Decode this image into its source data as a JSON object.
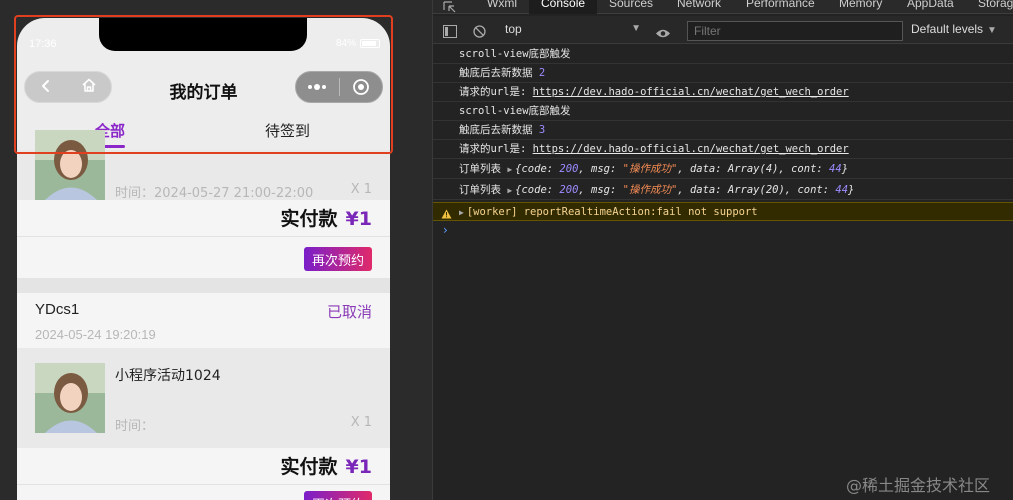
{
  "phone": {
    "status_time": "17:36",
    "battery_text": "84%",
    "nav_title": "我的订单",
    "tabs": [
      {
        "label": "全部",
        "active": true
      },
      {
        "label": "待签到",
        "active": false
      }
    ],
    "orders": [
      {
        "items": [
          {
            "name": "",
            "time": "时间：2024-05-27 21:00-22:00",
            "qty": "X 1"
          }
        ],
        "pay_label": "实付款",
        "pay_amount": "¥1",
        "rebook_label": "再次预约"
      },
      {
        "shop": "YDcs1",
        "status": "已取消",
        "date": "2024-05-24 19:20:19",
        "items": [
          {
            "name": "小程序活动1024",
            "time": "时间：",
            "qty": "X 1"
          }
        ],
        "pay_label": "实付款",
        "pay_amount": "¥1",
        "rebook_label": "再次预约"
      }
    ]
  },
  "devtools": {
    "tabs": [
      "Wxml",
      "Console",
      "Sources",
      "Network",
      "Performance",
      "Memory",
      "AppData",
      "Storag"
    ],
    "active_tab": "Console",
    "context": "top",
    "filter_placeholder": "Filter",
    "levels": "Default levels",
    "logs": [
      {
        "text": "scroll-view底部触发"
      },
      {
        "text": "触底后去新数据",
        "num": "2"
      },
      {
        "text": "请求的url是:",
        "url": "https://dev.hado-official.cn/wechat/get_wech_order"
      },
      {
        "text": "scroll-view底部触发"
      },
      {
        "text": "触底后去新数据",
        "num": "3"
      },
      {
        "text": "请求的url是:",
        "url": "https://dev.hado-official.cn/wechat/get_wech_order"
      },
      {
        "text": "订单列表",
        "obj": {
          "code": "200",
          "msg": "\"操作成功\"",
          "data": "Array(4)",
          "cont": "44"
        }
      },
      {
        "text": "订单列表",
        "obj": {
          "code": "200",
          "msg": "\"操作成功\"",
          "data": "Array(20)",
          "cont": "44"
        }
      }
    ],
    "warning": "[worker] reportRealtimeAction:fail not support",
    "prompt": "›"
  },
  "watermark": "@稀土掘金技术社区",
  "colors": {
    "accent_purple": "#8b27c9",
    "highlight_red": "#e0401f",
    "number_blue": "#9b8cff",
    "string_orange": "#f28b54"
  }
}
